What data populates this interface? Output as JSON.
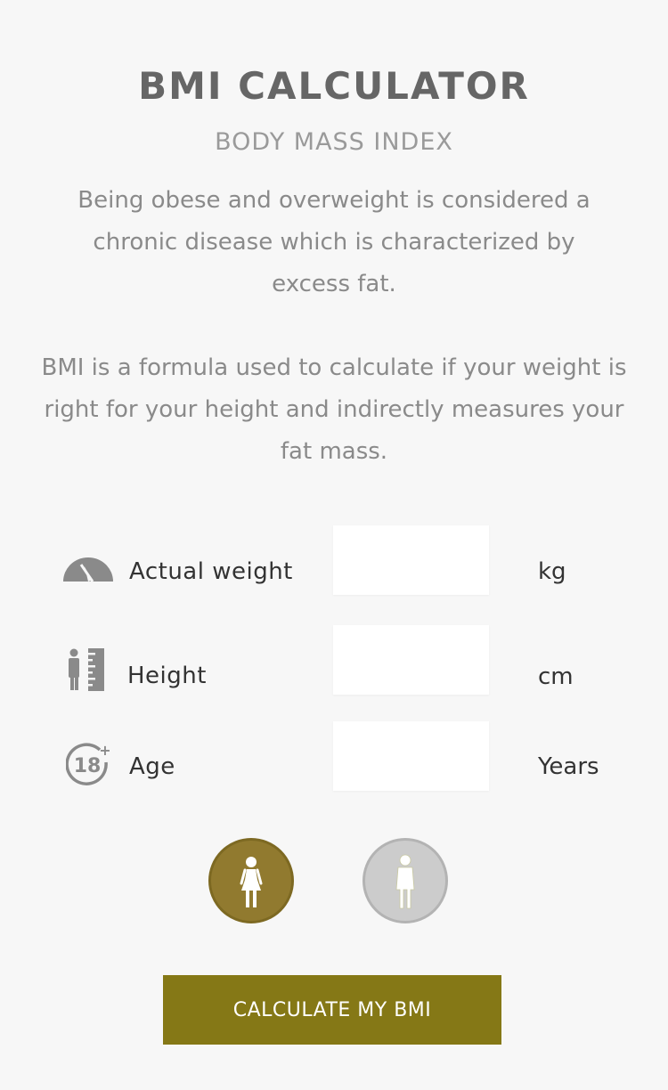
{
  "header": {
    "title": "BMI CALCULATOR",
    "subtitle": "BODY MASS INDEX"
  },
  "intro": {
    "paragraph1": "Being obese and overweight is considered a chronic disease which is characterized by excess fat.",
    "paragraph2": "BMI is a formula used to calculate if your weight is right for your height and indirectly measures your fat mass."
  },
  "form": {
    "weight": {
      "label": "Actual weight",
      "value": "",
      "unit": "kg",
      "icon": "scale-gauge-icon"
    },
    "height": {
      "label": "Height",
      "value": "",
      "unit": "cm",
      "icon": "height-ruler-icon"
    },
    "age": {
      "label": "Age",
      "value": "",
      "unit": "Years",
      "icon": "age-18-plus-icon"
    }
  },
  "gender": {
    "options": [
      {
        "id": "female",
        "icon": "female-figure-icon",
        "selected": true
      },
      {
        "id": "male",
        "icon": "male-figure-icon",
        "selected": false
      }
    ]
  },
  "actions": {
    "calculate_label": "CALCULATE MY BMI"
  },
  "colors": {
    "background": "#f7f7f7",
    "accent_gold": "#917a2f",
    "button_olive": "#857816",
    "inactive_gray": "#cccccc",
    "title_gray": "#666666"
  }
}
